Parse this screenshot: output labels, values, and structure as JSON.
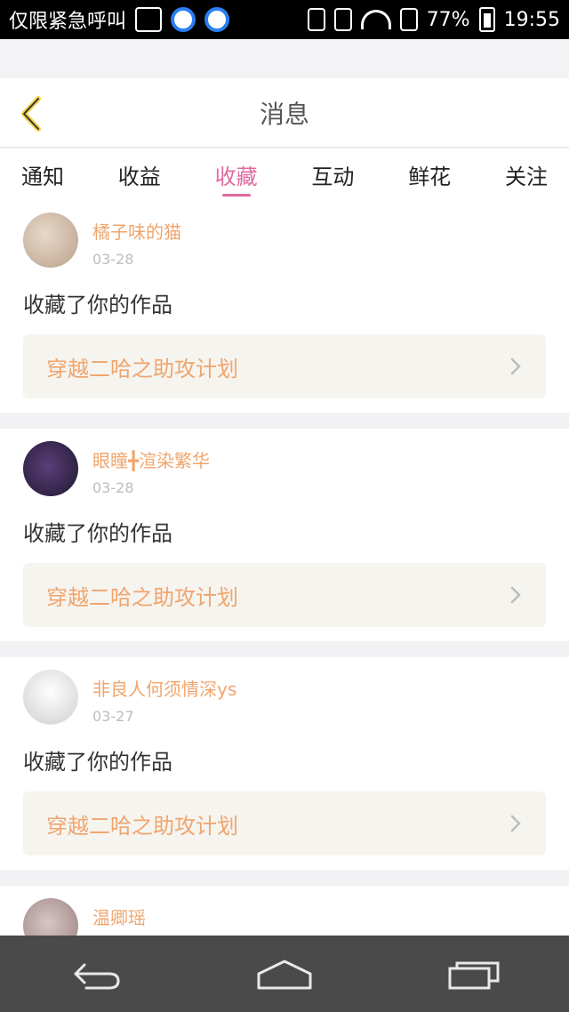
{
  "status_bar": {
    "left_text": "仅限紧急呼叫",
    "battery_pct": "77%",
    "time": "19:55"
  },
  "header": {
    "title": "消息",
    "back_icon": "back-chevron-icon"
  },
  "tabs": [
    {
      "label": "通知",
      "active": false
    },
    {
      "label": "收益",
      "active": false
    },
    {
      "label": "收藏",
      "active": true
    },
    {
      "label": "互动",
      "active": false
    },
    {
      "label": "鲜花",
      "active": false
    },
    {
      "label": "关注",
      "active": false
    }
  ],
  "messages": [
    {
      "user": "橘子味的猫",
      "date": "03-28",
      "text": "收藏了你的作品",
      "work": "穿越二哈之助攻计划"
    },
    {
      "user": "眼瞳╋渲染繁华",
      "date": "03-28",
      "text": "收藏了你的作品",
      "work": "穿越二哈之助攻计划"
    },
    {
      "user": "非良人何须情深ys",
      "date": "03-27",
      "text": "收藏了你的作品",
      "work": "穿越二哈之助攻计划"
    },
    {
      "user": "温卿瑶",
      "date": "",
      "text": "",
      "work": ""
    }
  ],
  "nav": {
    "back_icon": "back-icon",
    "home_icon": "home-icon",
    "recents_icon": "recents-icon"
  }
}
